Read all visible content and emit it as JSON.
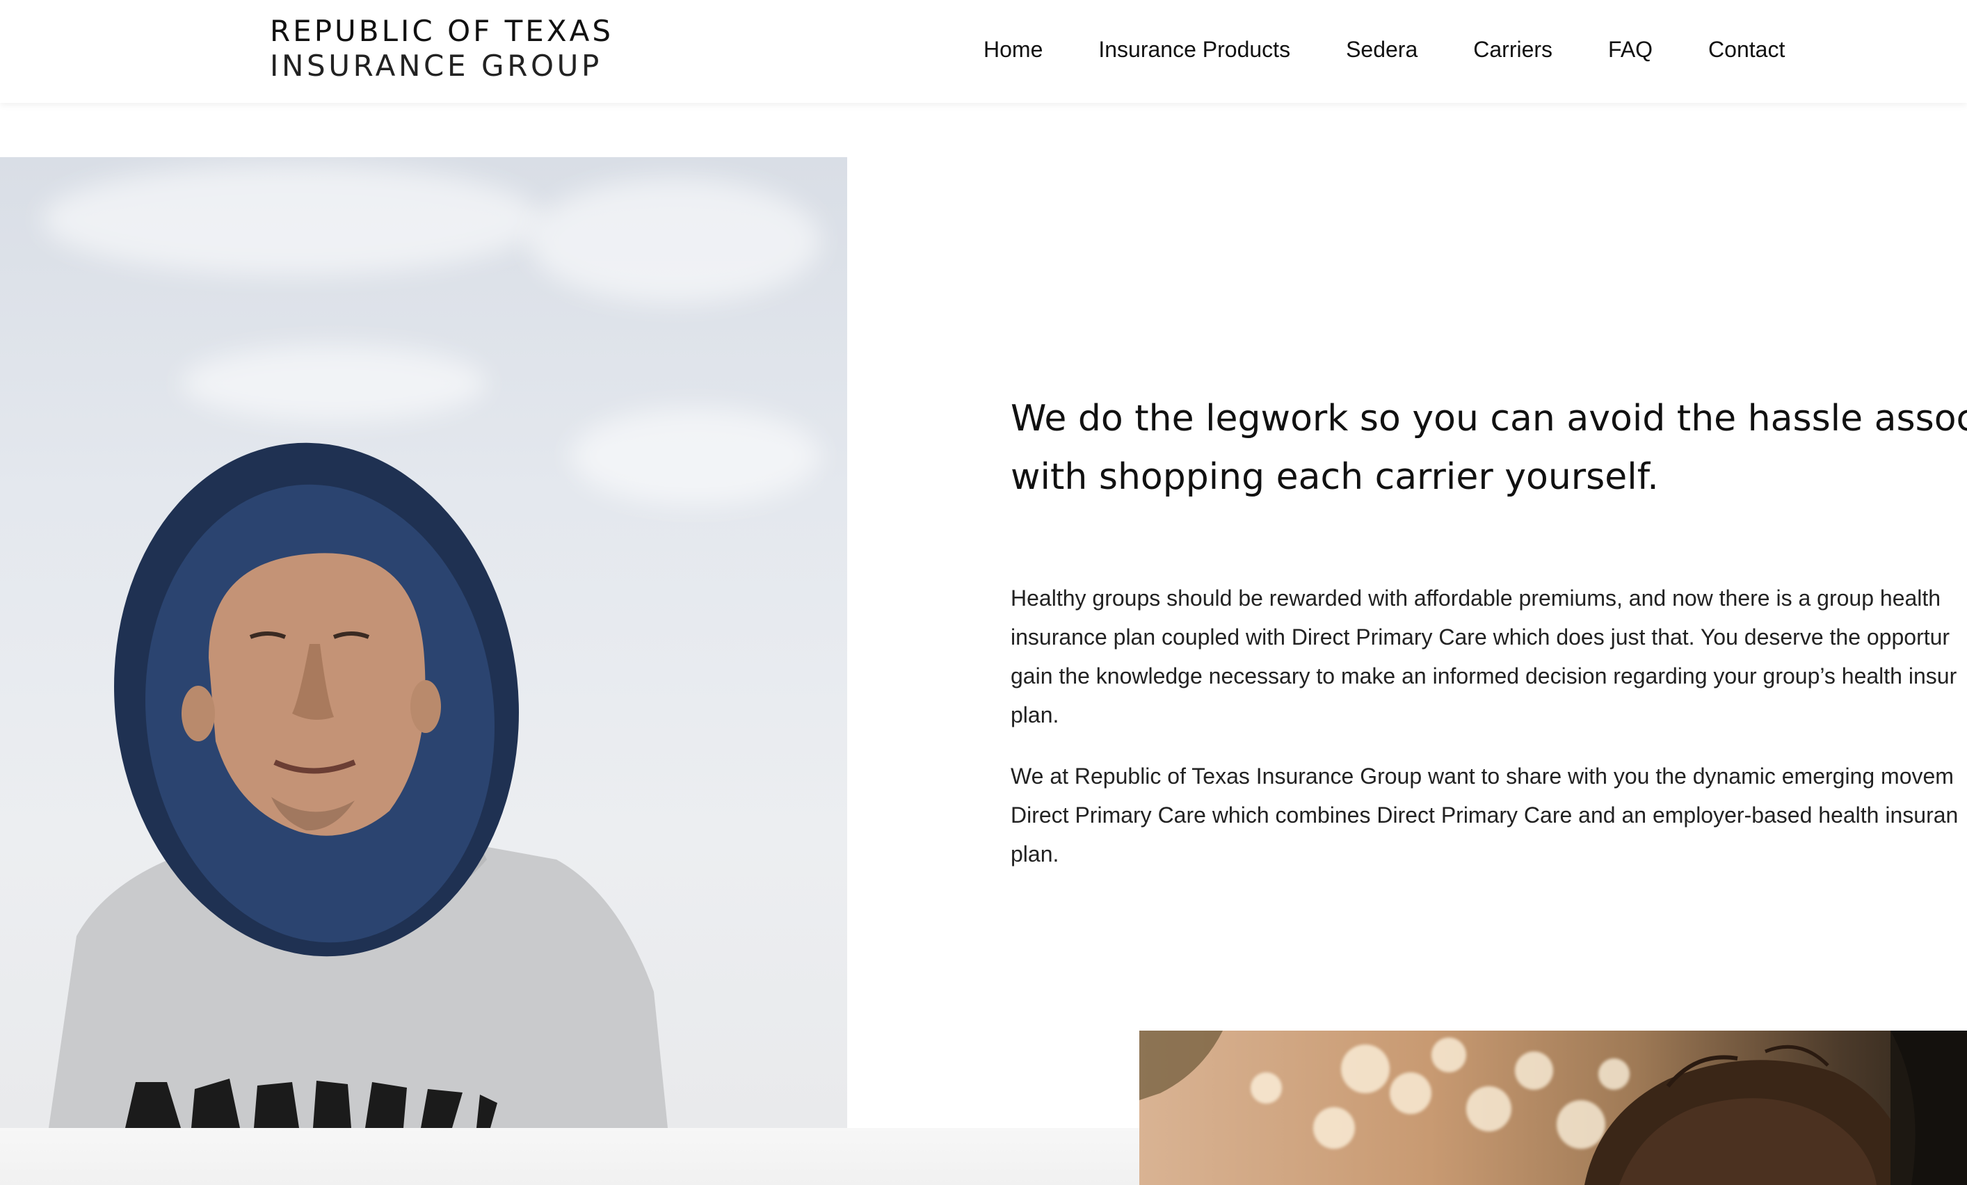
{
  "header": {
    "logo_line1": "REPUBLIC OF TEXAS",
    "logo_line2": "INSURANCE GROUP",
    "nav": [
      {
        "label": "Home"
      },
      {
        "label": "Insurance Products"
      },
      {
        "label": "Sedera"
      },
      {
        "label": "Carriers"
      },
      {
        "label": "FAQ"
      },
      {
        "label": "Contact"
      }
    ]
  },
  "hero": {
    "headline_line1": "We do the legwork so you can avoid the hassle associa",
    "headline_line2": "with shopping each carrier yourself.",
    "paragraph1_lines": [
      "Healthy groups should be rewarded with affordable premiums, and now there is a group health",
      "insurance plan coupled with Direct Primary Care which does just that. You deserve the opportur",
      "gain the knowledge necessary to make an informed decision regarding your group’s health insur",
      "plan."
    ],
    "paragraph2_lines": [
      "We at Republic of Texas Insurance Group want to share with you the dynamic emerging movem",
      "Direct Primary Care which combines Direct Primary Care and an employer-based health insuran",
      "plan."
    ]
  },
  "images": {
    "left_photo": "man-in-bucket-hat-photo",
    "right_photo": "woman-with-bokeh-lights-photo"
  },
  "colors": {
    "text": "#111111",
    "background": "#ffffff",
    "hat": "#1f3152",
    "sky": "#dfe3ea"
  }
}
